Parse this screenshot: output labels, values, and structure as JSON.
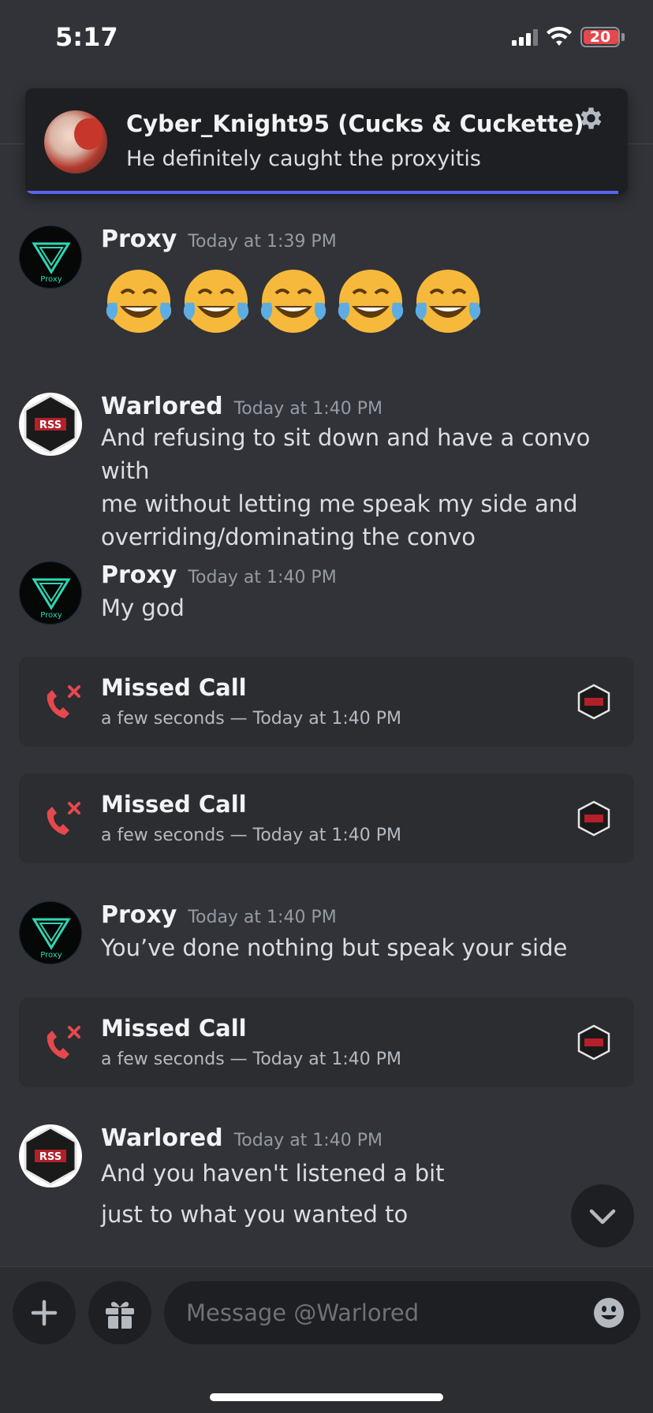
{
  "status_bar": {
    "time": "5:17",
    "battery": "20"
  },
  "notification": {
    "title": "Cyber_Knight95 (Cucks & Cuckette)",
    "body": "He definitely caught the proxyitis"
  },
  "messages": [
    {
      "author": "Proxy",
      "time": "Today at 1:39 PM",
      "emoji": [
        "face-with-tears-of-joy",
        "face-with-tears-of-joy",
        "face-with-tears-of-joy",
        "face-with-tears-of-joy",
        "face-with-tears-of-joy"
      ]
    },
    {
      "author": "Warlored",
      "time": "Today at 1:40 PM",
      "lines": [
        "And refusing to sit down and have a convo with",
        "me without letting me speak my side and",
        "overriding/dominating the convo"
      ]
    },
    {
      "author": "Proxy",
      "time": "Today at 1:40 PM",
      "text": "My god"
    },
    {
      "author": "Proxy",
      "time": "Today at 1:40 PM",
      "text": "You’ve done nothing but speak your side"
    },
    {
      "author": "Warlored",
      "time": "Today at 1:40 PM",
      "lines": [
        "And you haven't listened a bit",
        "just to what you wanted to"
      ]
    }
  ],
  "calls": [
    {
      "title": "Missed Call",
      "subtitle": "a few seconds — Today at 1:40 PM"
    },
    {
      "title": "Missed Call",
      "subtitle": "a few seconds — Today at 1:40 PM"
    },
    {
      "title": "Missed Call",
      "subtitle": "a few seconds — Today at 1:40 PM"
    }
  ],
  "avatar_labels": {
    "proxy": "Proxy",
    "warlored": "RSS"
  },
  "composer": {
    "placeholder": "Message @Warlored"
  },
  "colors": {
    "background": "#313338",
    "card": "#2b2d31",
    "accent": "#5865f2",
    "missed_call": "#e5484d",
    "proxy_logo": "#2fd7b4"
  },
  "icons": {
    "gear": "gear-icon",
    "missed_call": "missed-call-icon",
    "jump": "chevron-down-icon",
    "plus": "plus-icon",
    "gift": "gift-icon",
    "emoji": "emoji-icon"
  }
}
